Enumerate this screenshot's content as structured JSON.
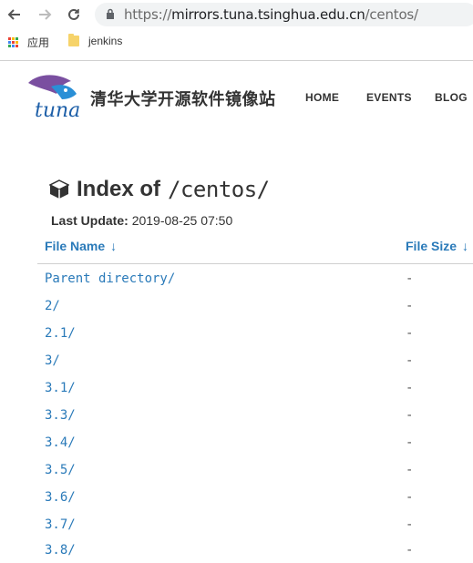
{
  "browser": {
    "url_scheme": "https://",
    "url_host": "mirrors.tuna.tsinghua.edu.cn",
    "url_path": "/centos/",
    "bookmarks": [
      {
        "label": "应用",
        "icon": "apps-grid-icon"
      },
      {
        "label": "jenkins",
        "icon": "folder-icon"
      }
    ]
  },
  "site": {
    "logo_text": "tuna",
    "title": "清华大学开源软件镜像站",
    "menu": [
      "HOME",
      "EVENTS",
      "BLOG"
    ]
  },
  "index": {
    "title_prefix": "Index of",
    "path": "/centos/",
    "last_update_label": "Last Update:",
    "last_update_value": "2019-08-25 07:50",
    "columns": {
      "name": "File Name",
      "size": "File Size",
      "sort_glyph": "↓"
    },
    "rows": [
      {
        "name": "Parent directory/",
        "size": "-"
      },
      {
        "name": "2/",
        "size": "-"
      },
      {
        "name": "2.1/",
        "size": "-"
      },
      {
        "name": "3/",
        "size": "-"
      },
      {
        "name": "3.1/",
        "size": "-"
      },
      {
        "name": "3.3/",
        "size": "-"
      },
      {
        "name": "3.4/",
        "size": "-"
      },
      {
        "name": "3.5/",
        "size": "-"
      },
      {
        "name": "3.6/",
        "size": "-"
      },
      {
        "name": "3.7/",
        "size": "-"
      },
      {
        "name": "3.8/",
        "size": "-"
      }
    ]
  },
  "colors": {
    "link": "#2a7ab9",
    "apps_grid": [
      "#ea4335",
      "#fbbc05",
      "#34a853",
      "#4285f4",
      "#ea4335",
      "#fbbc05",
      "#34a853",
      "#4285f4",
      "#ea4335"
    ]
  }
}
